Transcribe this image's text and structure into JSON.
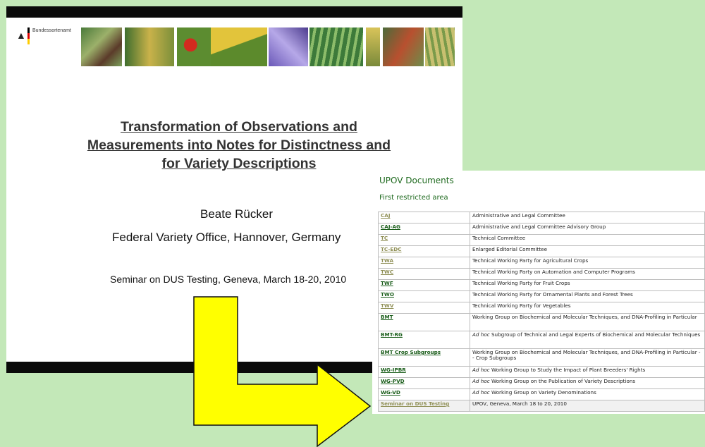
{
  "slide": {
    "agency": "Bundessortenamt",
    "title_lines": [
      "Transformation of Observations and",
      "Measurements into Notes for Distinctness and",
      "for Variety Descriptions"
    ],
    "author": "Beate Rücker",
    "affiliation": "Federal Variety Office, Hannover, Germany",
    "seminar": "Seminar on DUS Testing, Geneva, March 18-20, 2010"
  },
  "upov": {
    "title": "UPOV Documents",
    "subtitle": "First restricted area",
    "rows": [
      {
        "code": "CAJ",
        "desc": "Administrative and Legal Committee",
        "link_color": "light"
      },
      {
        "code": "CAJ-AG",
        "desc": "Administrative and Legal Committee Advisory Group",
        "link_color": "dark"
      },
      {
        "code": "TC",
        "desc": "Technical Committee",
        "link_color": "light"
      },
      {
        "code": "TC-EDC",
        "desc": "Enlarged Editorial Committee",
        "link_color": "light"
      },
      {
        "code": "TWA",
        "desc": "Technical Working Party for Agricultural Crops",
        "link_color": "light"
      },
      {
        "code": "TWC",
        "desc": "Technical Working Party on Automation and Computer Programs",
        "link_color": "light"
      },
      {
        "code": "TWF",
        "desc": "Technical Working Party for Fruit Crops",
        "link_color": "dark"
      },
      {
        "code": "TWO",
        "desc": "Technical Working Party for Ornamental Plants and Forest Trees",
        "link_color": "dark"
      },
      {
        "code": "TWV",
        "desc": "Technical Working Party for Vegetables",
        "link_color": "light"
      },
      {
        "code": "BMT",
        "desc": "Working Group on Biochemical and Molecular Techniques, and DNA-Profiling in Particular",
        "link_color": "dark"
      },
      {
        "code": "BMT-RG",
        "desc_italic": "Ad hoc",
        "desc": " Subgroup of Technical and Legal Experts of Biochemical and Molecular Techniques",
        "link_color": "dark"
      },
      {
        "code": "BMT Crop Subgroups",
        "desc": "Working Group on Biochemical and Molecular Techniques, and DNA-Profiling in Particular -- Crop Subgroups",
        "link_color": "dark"
      },
      {
        "code": "WG-IPBR",
        "desc_italic": "Ad hoc",
        "desc": " Working Group to Study the Impact of Plant Breeders' Rights",
        "link_color": "dark"
      },
      {
        "code": "WG-PVD",
        "desc_italic": "Ad hoc",
        "desc": " Working Group on the Publication of Variety Descriptions",
        "link_color": "dark"
      },
      {
        "code": "WG-VD",
        "desc_italic": "Ad hoc",
        "desc": " Working Group on Variety Denominations",
        "link_color": "dark"
      },
      {
        "code": "Seminar on DUS Testing",
        "desc": "UPOV, Geneva, March 18 to 20, 2010",
        "link_color": "light"
      }
    ]
  },
  "colors": {
    "background": "#c3e8b8",
    "arrow_fill": "#ffff00",
    "link_dark": "#1a5d1a",
    "link_light": "#8f8f55",
    "heading_green": "#1f6a1f"
  }
}
